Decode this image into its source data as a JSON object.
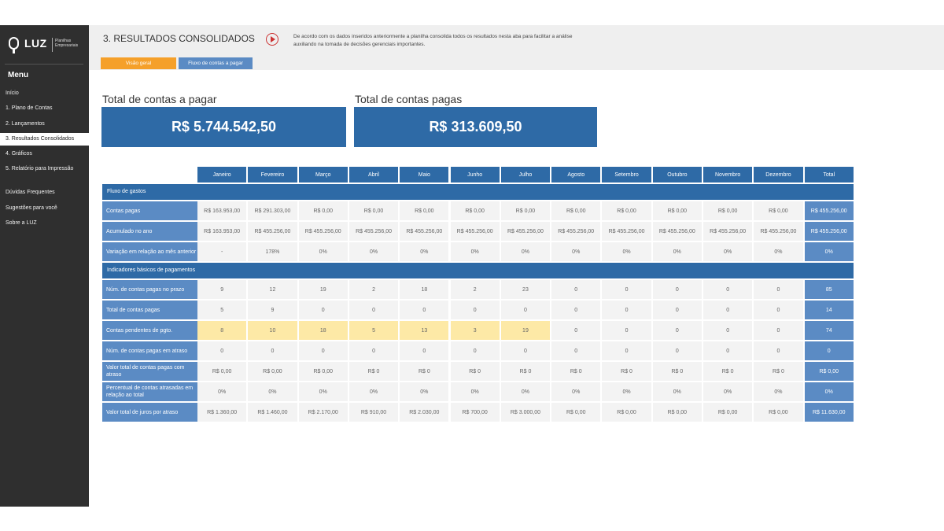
{
  "sidebar": {
    "logo_text": "LUZ",
    "logo_sub": "Planilhas Empresariais",
    "menu_title": "Menu",
    "items": [
      {
        "label": "Início"
      },
      {
        "label": "1. Plano de Contas"
      },
      {
        "label": "2. Lançamentos"
      },
      {
        "label": "3. Resultados Consolidados",
        "active": true
      },
      {
        "label": "4. Gráficos"
      },
      {
        "label": "5. Relatório para Impressão"
      },
      {
        "label": "Dúvidas Frequentes"
      },
      {
        "label": "Sugestões para você"
      },
      {
        "label": "Sobre a LUZ"
      }
    ]
  },
  "header": {
    "title": "3. RESULTADOS CONSOLIDADOS",
    "description": "De acordo com os dados inseridos anteriormente a planilha consolida todos os resultados nesta aba para facilitar a análise auxiliando na tomada de decisões gerenciais importantes.",
    "tabs": [
      {
        "label": "Visão geral"
      },
      {
        "label": "Fluxo de contas a pagar"
      }
    ]
  },
  "summary": {
    "payable_label": "Total de contas a pagar",
    "payable_value": "R$ 5.744.542,50",
    "paid_label": "Total de contas pagas",
    "paid_value": "R$ 313.609,50"
  },
  "table": {
    "columns": [
      "Janeiro",
      "Fevereiro",
      "Março",
      "Abril",
      "Maio",
      "Junho",
      "Julho",
      "Agosto",
      "Setembro",
      "Outubro",
      "Novembro",
      "Dezembro",
      "Total"
    ],
    "sections": [
      {
        "title": "Fluxo de gastos",
        "rows": [
          {
            "label": "Contas pagas",
            "values": [
              "R$ 163.953,00",
              "R$ 291.303,00",
              "R$ 0,00",
              "R$ 0,00",
              "R$ 0,00",
              "R$ 0,00",
              "R$ 0,00",
              "R$ 0,00",
              "R$ 0,00",
              "R$ 0,00",
              "R$ 0,00",
              "R$ 0,00",
              "R$ 455.256,00"
            ]
          },
          {
            "label": "Acumulado no ano",
            "values": [
              "R$ 163.953,00",
              "R$ 455.256,00",
              "R$ 455.256,00",
              "R$ 455.256,00",
              "R$ 455.256,00",
              "R$ 455.256,00",
              "R$ 455.256,00",
              "R$ 455.256,00",
              "R$ 455.256,00",
              "R$ 455.256,00",
              "R$ 455.256,00",
              "R$ 455.256,00",
              "R$ 455.256,00"
            ]
          },
          {
            "label": "Variação em relação ao mês anterior",
            "values": [
              "-",
              "178%",
              "0%",
              "0%",
              "0%",
              "0%",
              "0%",
              "0%",
              "0%",
              "0%",
              "0%",
              "0%",
              "0%"
            ]
          }
        ]
      },
      {
        "title": "Indicadores básicos de pagamentos",
        "rows": [
          {
            "label": "Núm. de contas pagas no prazo",
            "values": [
              "9",
              "12",
              "19",
              "2",
              "18",
              "2",
              "23",
              "0",
              "0",
              "0",
              "0",
              "0",
              "85"
            ]
          },
          {
            "label": "Total de contas pagas",
            "values": [
              "5",
              "9",
              "0",
              "0",
              "0",
              "0",
              "0",
              "0",
              "0",
              "0",
              "0",
              "0",
              "14"
            ]
          },
          {
            "label": "Contas pendentes de pgto.",
            "highlight": 7,
            "values": [
              "8",
              "10",
              "18",
              "5",
              "13",
              "3",
              "19",
              "0",
              "0",
              "0",
              "0",
              "0",
              "74"
            ]
          },
          {
            "label": "Núm. de contas pagas em atraso",
            "values": [
              "0",
              "0",
              "0",
              "0",
              "0",
              "0",
              "0",
              "0",
              "0",
              "0",
              "0",
              "0",
              "0"
            ]
          },
          {
            "label": "Valor total de contas pagas com atraso",
            "values": [
              "R$ 0,00",
              "R$ 0,00",
              "R$ 0,00",
              "R$ 0",
              "R$ 0",
              "R$ 0",
              "R$ 0",
              "R$ 0",
              "R$ 0",
              "R$ 0",
              "R$ 0",
              "R$ 0",
              "R$ 0,00"
            ]
          },
          {
            "label": "Percentual de contas atrasadas em relação ao total",
            "values": [
              "0%",
              "0%",
              "0%",
              "0%",
              "0%",
              "0%",
              "0%",
              "0%",
              "0%",
              "0%",
              "0%",
              "0%",
              "0%"
            ]
          },
          {
            "label": "Valor total de juros por atraso",
            "values": [
              "R$ 1.360,00",
              "R$ 1.460,00",
              "R$ 2.170,00",
              "R$ 910,00",
              "R$ 2.030,00",
              "R$ 700,00",
              "R$ 3.000,00",
              "R$ 0,00",
              "R$ 0,00",
              "R$ 0,00",
              "R$ 0,00",
              "R$ 0,00",
              "R$ 11.630,00"
            ]
          }
        ]
      }
    ]
  }
}
